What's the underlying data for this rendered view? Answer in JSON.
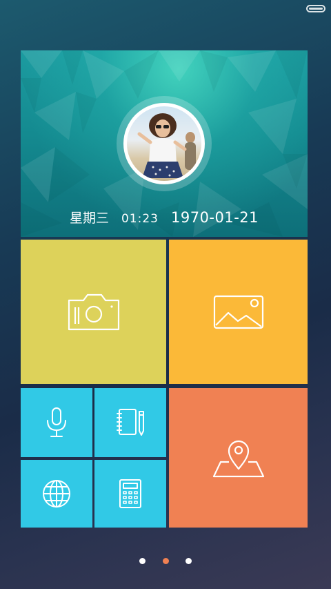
{
  "status_bar": {
    "battery_icon": "battery-icon"
  },
  "profile_card": {
    "weekday": "星期三",
    "time": "01:23",
    "date": "1970-01-21",
    "avatar_icon": "avatar-photo"
  },
  "tiles": [
    {
      "id": "camera",
      "icon": "camera-icon",
      "color": "#ddd25a"
    },
    {
      "id": "gallery",
      "icon": "image-icon",
      "color": "#fbb938"
    },
    {
      "id": "recorder",
      "icon": "microphone-icon",
      "color": "#31c9e6"
    },
    {
      "id": "notes",
      "icon": "notebook-icon",
      "color": "#31c9e6"
    },
    {
      "id": "browser",
      "icon": "globe-icon",
      "color": "#31c9e6"
    },
    {
      "id": "calculator",
      "icon": "calculator-icon",
      "color": "#31c9e6"
    },
    {
      "id": "maps",
      "icon": "map-pin-icon",
      "color": "#f08153"
    }
  ],
  "pager": {
    "pages": 3,
    "current_page": 2,
    "active_color": "#f08153",
    "inactive_color": "#ffffff"
  }
}
